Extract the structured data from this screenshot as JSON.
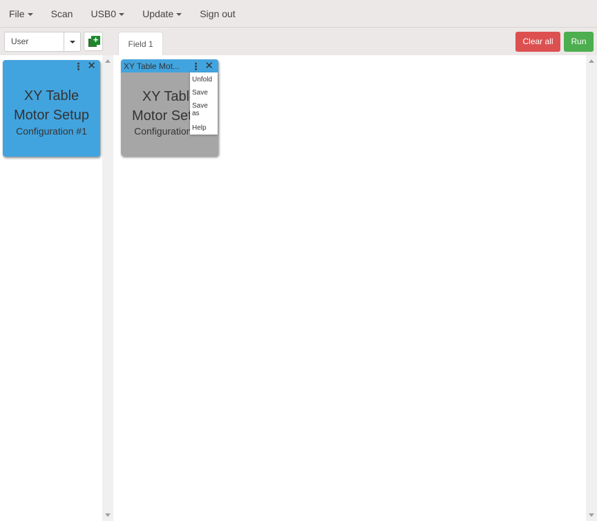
{
  "menubar": {
    "items": [
      {
        "label": "File",
        "dropdown": true
      },
      {
        "label": "Scan",
        "dropdown": false
      },
      {
        "label": "USB0",
        "dropdown": true
      },
      {
        "label": "Update",
        "dropdown": true
      },
      {
        "label": "Sign out",
        "dropdown": false
      }
    ]
  },
  "toolbar": {
    "user_select": {
      "value": "User"
    },
    "add_icon": "add-block-icon",
    "tabs": [
      {
        "label": "Field 1",
        "active": true
      }
    ],
    "clear_all_label": "Clear all",
    "run_label": "Run",
    "colors": {
      "clear_all": "#dd5050",
      "run": "#4cae4f"
    }
  },
  "palette": {
    "cards": [
      {
        "title_line1": "XY Table",
        "title_line2": "Motor Setup",
        "subtitle": "Configuration #1",
        "color": "#42a4df"
      }
    ]
  },
  "canvas": {
    "blocks": [
      {
        "header": "XY Table Mot...",
        "title_line1": "XY Table",
        "title_line2": "Motor Setup",
        "subtitle": "Configuration #1",
        "header_color": "#42a4df",
        "body_color": "#a6a6a6"
      }
    ],
    "context_menu": {
      "items": [
        "Unfold",
        "Save",
        "Save as",
        "Help"
      ]
    }
  },
  "icons": {
    "more": "more-vertical-icon",
    "close": "close-icon"
  }
}
